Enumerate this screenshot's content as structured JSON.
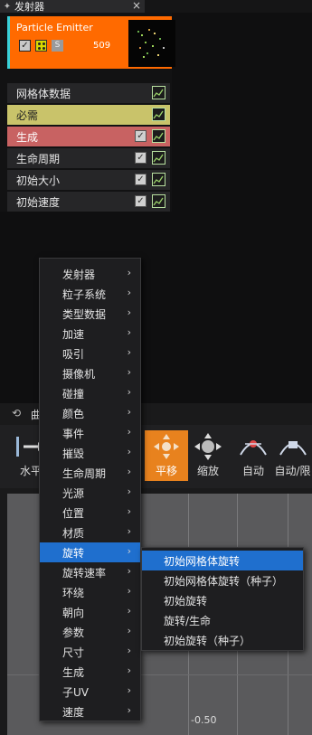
{
  "tab": {
    "title": "发射器",
    "close": "×"
  },
  "emitter": {
    "name": "Particle Emitter",
    "count": "509",
    "s_label": "S",
    "colors": {
      "header": "#ff6a00",
      "accent": "#3ad0d8"
    }
  },
  "modules": [
    {
      "label": "网格体数据",
      "checkbox": false
    },
    {
      "label": "必需",
      "checkbox": false,
      "style": "required"
    },
    {
      "label": "生成",
      "checkbox": true,
      "style": "spawn"
    },
    {
      "label": "生命周期",
      "checkbox": true
    },
    {
      "label": "初始大小",
      "checkbox": true
    },
    {
      "label": "初始速度",
      "checkbox": true
    }
  ],
  "curve_editor": {
    "tab_label": "曲",
    "tools": [
      {
        "label": "水平",
        "icon": "fit-horizontal-icon"
      },
      {
        "label": "平移",
        "icon": "pan-icon",
        "active": true
      },
      {
        "label": "缩放",
        "icon": "zoom-icon"
      },
      {
        "label": "自动",
        "icon": "auto-curve-icon"
      },
      {
        "label": "自动/限",
        "icon": "auto-clamped-icon"
      }
    ],
    "tick_label": "-0.50"
  },
  "context_menu": {
    "items": [
      "发射器",
      "粒子系统",
      "类型数据",
      "加速",
      "吸引",
      "摄像机",
      "碰撞",
      "颜色",
      "事件",
      "摧毁",
      "生命周期",
      "光源",
      "位置",
      "材质",
      "旋转",
      "旋转速率",
      "环绕",
      "朝向",
      "参数",
      "尺寸",
      "生成",
      "子UV",
      "速度"
    ],
    "selected_index": 14,
    "arrow": "›"
  },
  "submenu": {
    "items": [
      "初始网格体旋转",
      "初始网格体旋转（种子）",
      "初始旋转",
      "旋转/生命",
      "初始旋转（种子）"
    ],
    "selected_index": 0
  }
}
